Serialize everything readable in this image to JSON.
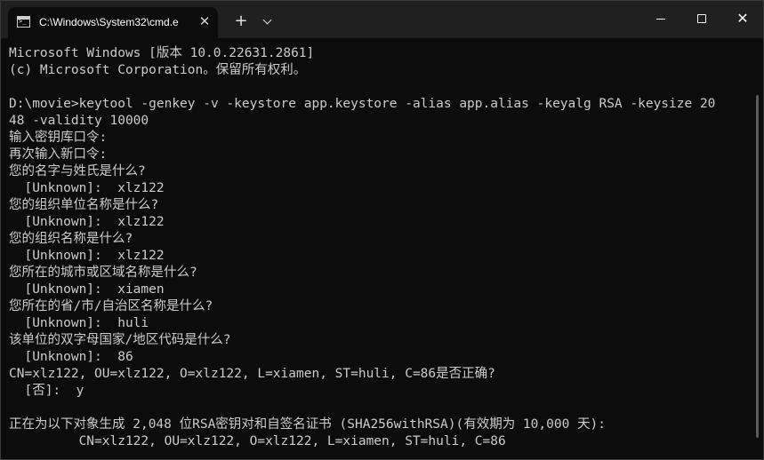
{
  "tab": {
    "title": "C:\\Windows\\System32\\cmd.e",
    "close_glyph": "✕"
  },
  "tabbar": {
    "new_tab_glyph": "+"
  },
  "window_controls": {
    "close_glyph": "✕"
  },
  "console": {
    "lines": [
      "Microsoft Windows [版本 10.0.22631.2861]",
      "(c) Microsoft Corporation。保留所有权利。",
      "",
      "D:\\movie>keytool -genkey -v -keystore app.keystore -alias app.alias -keyalg RSA -keysize 20",
      "48 -validity 10000",
      "输入密钥库口令:",
      "再次输入新口令:",
      "您的名字与姓氏是什么?",
      "  [Unknown]:  xlz122",
      "您的组织单位名称是什么?",
      "  [Unknown]:  xlz122",
      "您的组织名称是什么?",
      "  [Unknown]:  xlz122",
      "您所在的城市或区域名称是什么?",
      "  [Unknown]:  xiamen",
      "您所在的省/市/自治区名称是什么?",
      "  [Unknown]:  huli",
      "该单位的双字母国家/地区代码是什么?",
      "  [Unknown]:  86",
      "CN=xlz122, OU=xlz122, O=xlz122, L=xiamen, ST=huli, C=86是否正确?",
      "  [否]:  y",
      "",
      "正在为以下对象生成 2,048 位RSA密钥对和自签名证书 (SHA256withRSA)(有效期为 10,000 天):",
      "         CN=xlz122, OU=xlz122, O=xlz122, L=xiamen, ST=huli, C=86"
    ]
  },
  "colors": {
    "background": "#0c0c0c",
    "titlebar": "#202020",
    "text": "#cccccc"
  }
}
